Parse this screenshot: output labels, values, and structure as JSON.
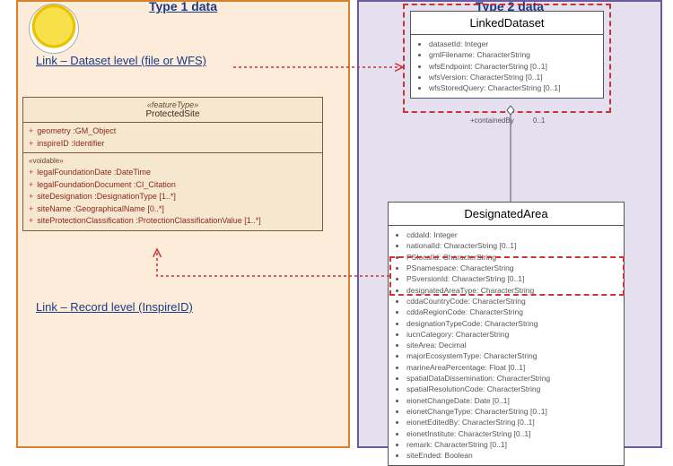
{
  "leftPane": {
    "title": "Type 1 data",
    "link1": "Link – Dataset level (file or WFS)",
    "link2": "Link – Record level (InspireID)"
  },
  "rightPane": {
    "title": "Type 2 data"
  },
  "protectedSite": {
    "stereotype": "«featureType»",
    "name": "ProtectedSite",
    "attrs1": [
      "geometry  :GM_Object",
      "inspireID  :Identifier"
    ],
    "voidable": "«voidable»",
    "attrs2": [
      "legalFoundationDate  :DateTime",
      "legalFoundationDocument  :CI_Citation",
      "siteDesignation  :DesignationType [1..*]",
      "siteName  :GeographicalName [0..*]",
      "siteProtectionClassification  :ProtectionClassificationValue [1..*]"
    ]
  },
  "linkedDataset": {
    "name": "LinkedDataset",
    "attrs": [
      "datasetId: Integer",
      "gmlFilename: CharacterString",
      "wfsEndpoint: CharacterString [0..1]",
      "wfsVersion: CharacterString [0..1]",
      "wfsStoredQuery: CharacterString [0..1]"
    ]
  },
  "designatedArea": {
    "name": "DesignatedArea",
    "attrs": [
      "cddaId: Integer",
      "nationalId: CharacterString [0..1]",
      "PSlocalId: CharacterString",
      "PSnamespace: CharacterString",
      "PSversionId: CharacterString [0..1]",
      "designatedAreaType: CharacterString",
      "cddaCountryCode: CharacterString",
      "cddaRegionCode: CharacterString",
      "designationTypeCode: CharacterString",
      "iucnCategory: CharacterString",
      "siteArea: Decimal",
      "majorEcosystemType: CharacterString",
      "marineAreaPercentage: Float [0..1]",
      "spatialDataDissemination: CharacterString",
      "spatialResolutionCode: CharacterString",
      "eionetChangeDate: Date [0..1]",
      "eionetChangeType: CharacterString [0..1]",
      "eionetEditedBy: CharacterString [0..1]",
      "eionetInstitute: CharacterString [0..1]",
      "remark: CharacterString [0..1]",
      "siteEnded: Boolean"
    ]
  },
  "assoc": {
    "role": "+containedBy",
    "mult": "0..1"
  }
}
